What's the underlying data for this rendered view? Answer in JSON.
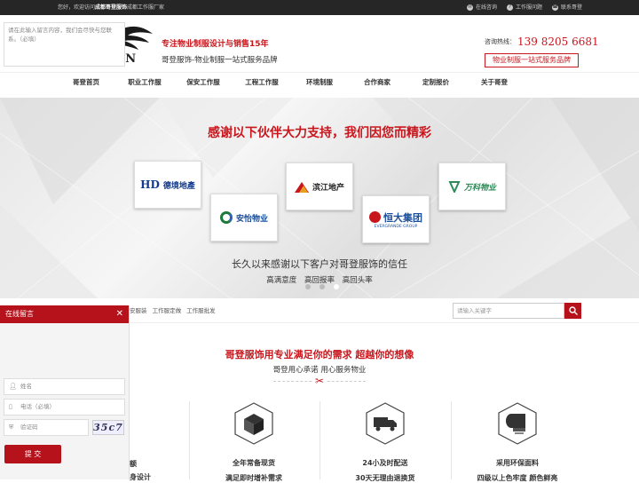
{
  "topbar": {
    "welcome_prefix": "您好，欢迎访问",
    "welcome_brand": "成都哥登服饰",
    "welcome_suffix": "成都工作服厂家",
    "links": [
      {
        "label": "在线咨询",
        "icon": "chat-icon"
      },
      {
        "label": "工作服问题",
        "icon": "question-icon"
      },
      {
        "label": "联系哥登",
        "icon": "phone-icon"
      }
    ]
  },
  "header": {
    "logo_text": "GORDEN",
    "slogan_main": "专注物业制服设计与销售15年",
    "slogan_sub": "哥登服饰-物业制服一站式服务品牌",
    "hotline_label": "咨询热线：",
    "hotline_number": "139 8205 6681",
    "badge": "物业制服一站式服务品牌"
  },
  "nav": [
    "哥登首页",
    "职业工作服",
    "保安工作服",
    "工程工作服",
    "环境制服",
    "合作商家",
    "定制报价",
    "关于哥登"
  ],
  "banner": {
    "title": "感谢以下伙伴大力支持，我们因您而精彩",
    "partners": [
      {
        "name": "德境地產",
        "mark": "HD"
      },
      {
        "name": "安怡物业",
        "mark": ""
      },
      {
        "name": "滨江地产",
        "mark": ""
      },
      {
        "name": "恒大集团",
        "mark": "EVERGRANDE GROUP"
      },
      {
        "name": "万科物业",
        "mark": ""
      }
    ],
    "subtitle": "长久以来感谢以下客户对哥登服饰的信任",
    "tags": "高满意度 高回报率 高回头率"
  },
  "search": {
    "hotwords": "安服装 工作服定做 工作服批发",
    "placeholder": "请输入关键字"
  },
  "section": {
    "title": "哥登服饰用专业满足你的需求 超越你的想像",
    "subtitle": "哥登用心承诺 用心服务物业",
    "features": [
      {
        "icon": "box-icon",
        "line1": "全年常备现货",
        "line2": "满足即时增补需求"
      },
      {
        "icon": "truck-icon",
        "line1": "24小及时配送",
        "line2": "30天无理由退换货"
      },
      {
        "icon": "fabric-roll-icon",
        "line1": "采用环保面料",
        "line2": "四级以上色牢度 颜色鲜亮"
      }
    ],
    "partial_left": {
      "line1": "额",
      "line2": "身设计"
    }
  },
  "message_panel": {
    "title": "在线留言",
    "textarea_placeholder": "请在此输入留言内容，我们会尽快与您联系。（必填）",
    "name_placeholder": "姓名",
    "phone_placeholder": "电话（必填）",
    "captcha_placeholder": "验证码",
    "captcha_text": "35c7",
    "submit_label": "提 交"
  },
  "colors": {
    "brand_red": "#c8161d",
    "dark_bar": "#262626"
  }
}
